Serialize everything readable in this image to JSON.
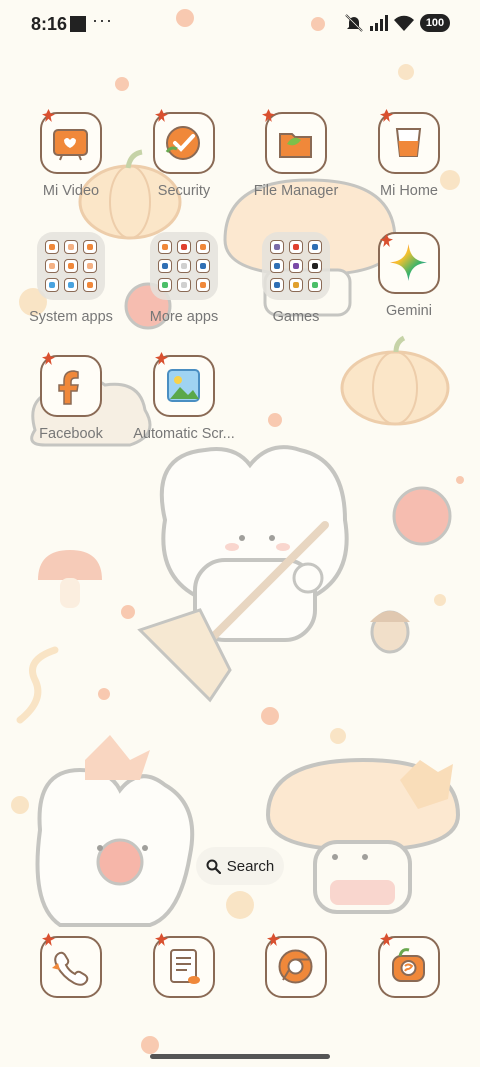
{
  "status_bar": {
    "time": "8:16",
    "extras": "···",
    "battery": "100"
  },
  "apps": [
    {
      "name": "mi-video-app",
      "icon": "tv-icon",
      "label": "Mi Video"
    },
    {
      "name": "security-app",
      "icon": "security-icon",
      "label": "Security"
    },
    {
      "name": "file-manager-app",
      "icon": "folder-icon",
      "label": "File Manager"
    },
    {
      "name": "mi-home-app",
      "icon": "cup-icon",
      "label": "Mi Home"
    },
    {
      "name": "system-apps-folder",
      "icon": "folder-grid-icon",
      "label": "System apps"
    },
    {
      "name": "more-apps-folder",
      "icon": "folder-grid-icon",
      "label": "More apps"
    },
    {
      "name": "games-folder",
      "icon": "folder-grid-icon",
      "label": "Games"
    },
    {
      "name": "gemini-app",
      "icon": "gemini-star-icon",
      "label": "Gemini"
    },
    {
      "name": "facebook-app",
      "icon": "facebook-icon",
      "label": "Facebook"
    },
    {
      "name": "automatic-scroll-app",
      "icon": "photo-icon",
      "label": "Automatic Scr..."
    }
  ],
  "search": {
    "label": "Search"
  },
  "dock": [
    {
      "name": "dock-phone",
      "icon": "phone-icon"
    },
    {
      "name": "dock-notes",
      "icon": "notes-icon"
    },
    {
      "name": "dock-chrome",
      "icon": "chrome-icon"
    },
    {
      "name": "dock-camera",
      "icon": "camera-icon"
    }
  ],
  "colors": {
    "accent_orange": "#f0883a",
    "icon_outline": "#8a6a55",
    "leaf_red": "#d9502f",
    "background": "#fdfbf3"
  }
}
